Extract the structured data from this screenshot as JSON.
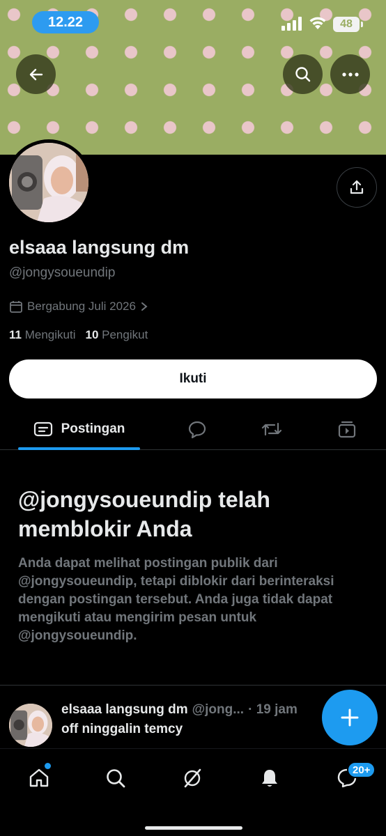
{
  "status_bar": {
    "time": "12.22",
    "battery": "48"
  },
  "profile": {
    "display_name": "elsaaa langsung dm",
    "handle": "@jongysoueundip",
    "joined": "Bergabung Juli 2026",
    "following_count": "11",
    "following_label": "Mengikuti",
    "followers_count": "10",
    "followers_label": "Pengikut",
    "follow_button": "Ikuti"
  },
  "tabs": [
    {
      "label": "Postingan",
      "icon": "posts-icon",
      "active": true
    },
    {
      "label": "",
      "icon": "reply-icon"
    },
    {
      "label": "",
      "icon": "repost-icon"
    },
    {
      "label": "",
      "icon": "media-icon"
    }
  ],
  "blocked": {
    "title": "@jongysoueundip telah memblokir Anda",
    "description": "Anda dapat melihat postingan publik dari @jongysoueundip, tetapi diblokir dari berinteraksi dengan postingan tersebut. Anda juga tidak dapat mengikuti atau mengirim pesan untuk @jongysoueundip."
  },
  "post": {
    "name": "elsaaa langsung dm",
    "handle_truncated": "@jong...",
    "time": "· 19 jam",
    "text": "off ninggalin temcy"
  },
  "bottom_nav": {
    "items": [
      "home-icon",
      "search-icon",
      "grok-icon",
      "notifications-icon",
      "messages-icon"
    ],
    "messages_badge": "20+"
  },
  "colors": {
    "accent": "#1d9bf0",
    "banner": "#9aad63",
    "dots": "#e9c6c9"
  }
}
